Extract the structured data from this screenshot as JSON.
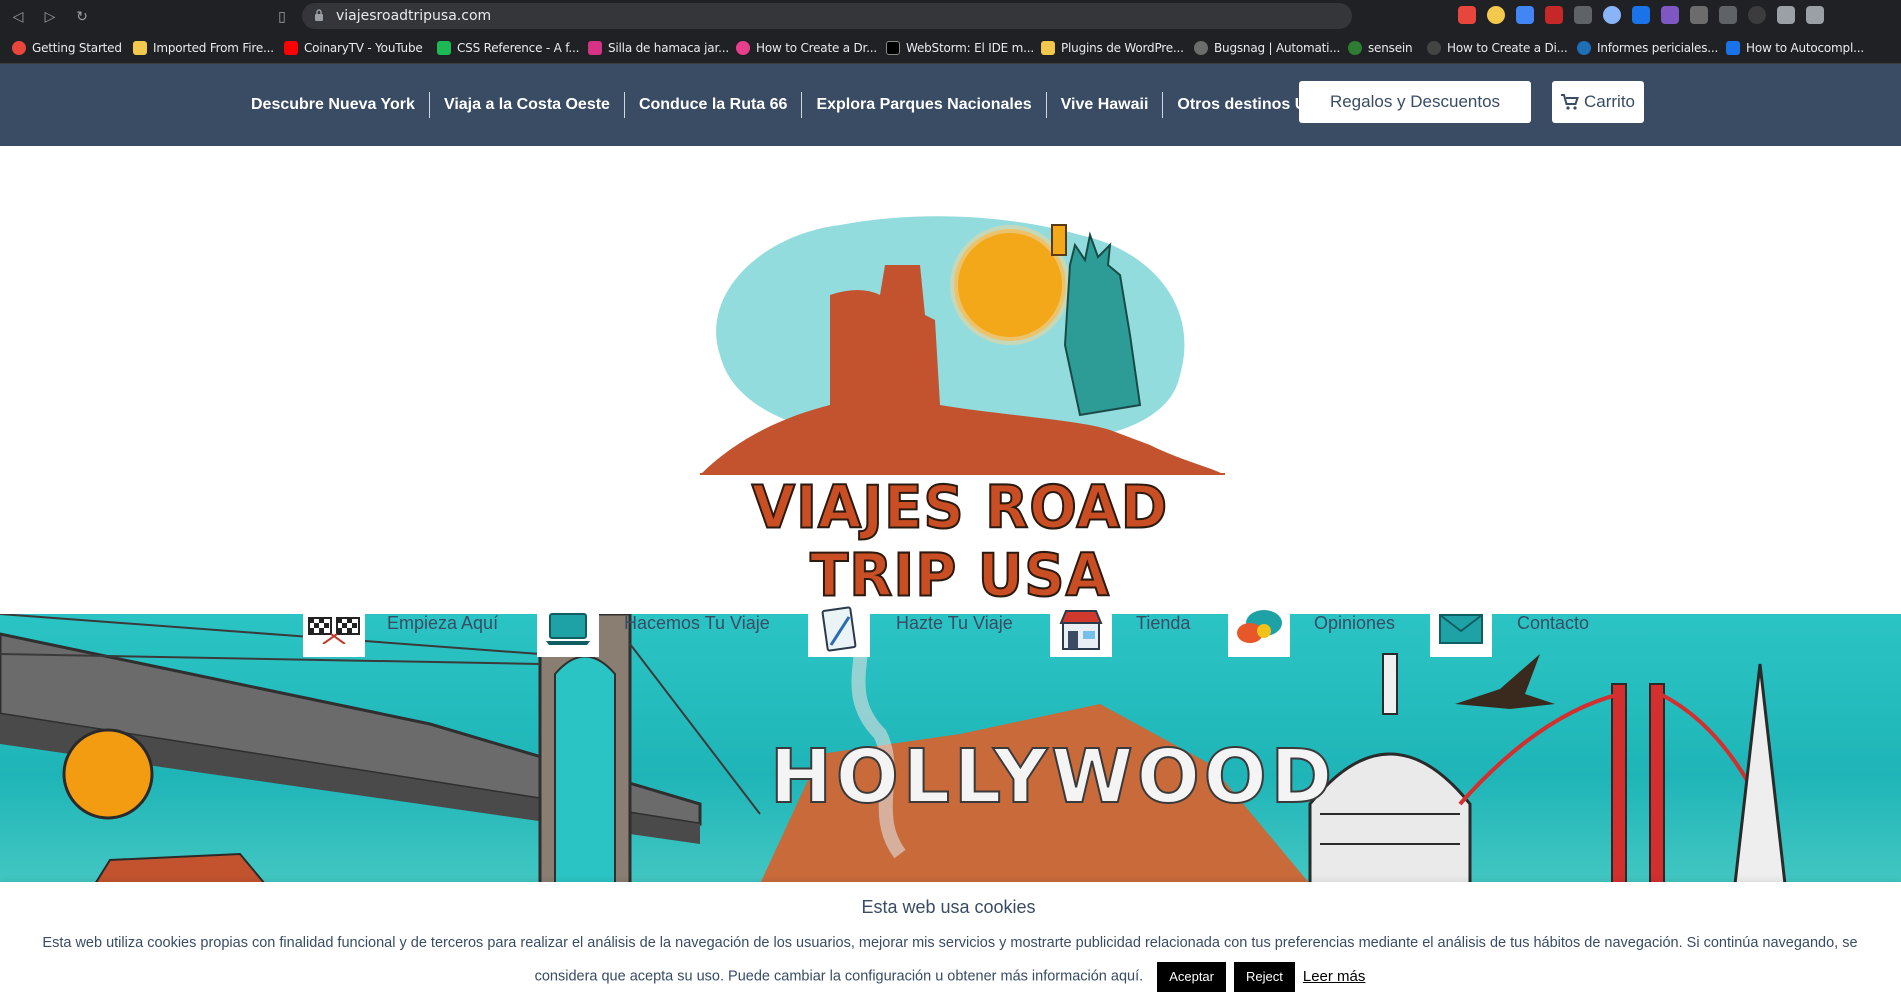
{
  "browser": {
    "url": "viajesroadtripusa.com",
    "bookmarks": [
      {
        "label": "Getting Started",
        "color": "#e8453c"
      },
      {
        "label": "Imported From Fire...",
        "color": "#f2c94c"
      },
      {
        "label": "CoinaryTV - YouTube",
        "color": "#ff0000"
      },
      {
        "label": "CSS Reference - A f...",
        "color": "#1db954"
      },
      {
        "label": "Silla de hamaca jar...",
        "color": "#d63384"
      },
      {
        "label": "How to Create a Dr...",
        "color": "#e83e8c"
      },
      {
        "label": "WebStorm: El IDE m...",
        "color": "#000000"
      },
      {
        "label": "Plugins de WordPre...",
        "color": "#f2c94c"
      },
      {
        "label": "Bugsnag | Automati...",
        "color": "#6c6c6c"
      },
      {
        "label": "sensein",
        "color": "#2e7d32"
      },
      {
        "label": "How to Create a Di...",
        "color": "#444444"
      },
      {
        "label": "Informes periciales...",
        "color": "#1e6fb8"
      },
      {
        "label": "How to Autocompl...",
        "color": "#1a73e8"
      }
    ]
  },
  "nav": {
    "menu": [
      "Descubre Nueva York",
      "Viaja a la Costa Oeste",
      "Conduce la Ruta 66",
      "Explora Parques Nacionales",
      "Vive Hawaii",
      "Otros destinos USA"
    ],
    "regalos_label": "Regalos y Descuentos",
    "carrito_label": "Carrito"
  },
  "logo": {
    "title": "VIAJES ROAD TRIP USA"
  },
  "hero": {
    "sign": "HOLLYWOOD"
  },
  "quick_links": [
    {
      "label": "Empieza Aquí",
      "icon": "checkered-flags-icon"
    },
    {
      "label": "Hacemos Tu Viaje",
      "icon": "laptop-icon"
    },
    {
      "label": "Hazte Tu Viaje",
      "icon": "notepad-icon"
    },
    {
      "label": "Tienda",
      "icon": "store-icon"
    },
    {
      "label": "Opiniones",
      "icon": "chat-bubbles-icon"
    },
    {
      "label": "Contacto",
      "icon": "envelope-icon"
    }
  ],
  "cookie": {
    "title": "Esta web usa cookies",
    "text": "Esta web utiliza cookies propias con finalidad funcional y de terceros para realizar el análisis de la navegación de los usuarios, mejorar mis servicios y mostrarte publicidad relacionada con tus preferencias mediante el análisis de tus hábitos de navegación. Si continúa navegando, se considera que acepta su uso. Puede cambiar la configuración u obtener más información aquí.",
    "accept_label": "Aceptar",
    "reject_label": "Reject",
    "more_label": "Leer más"
  },
  "colors": {
    "nav_bg": "#394c64",
    "accent": "#c94e24",
    "teal": "#2bc4c4"
  }
}
